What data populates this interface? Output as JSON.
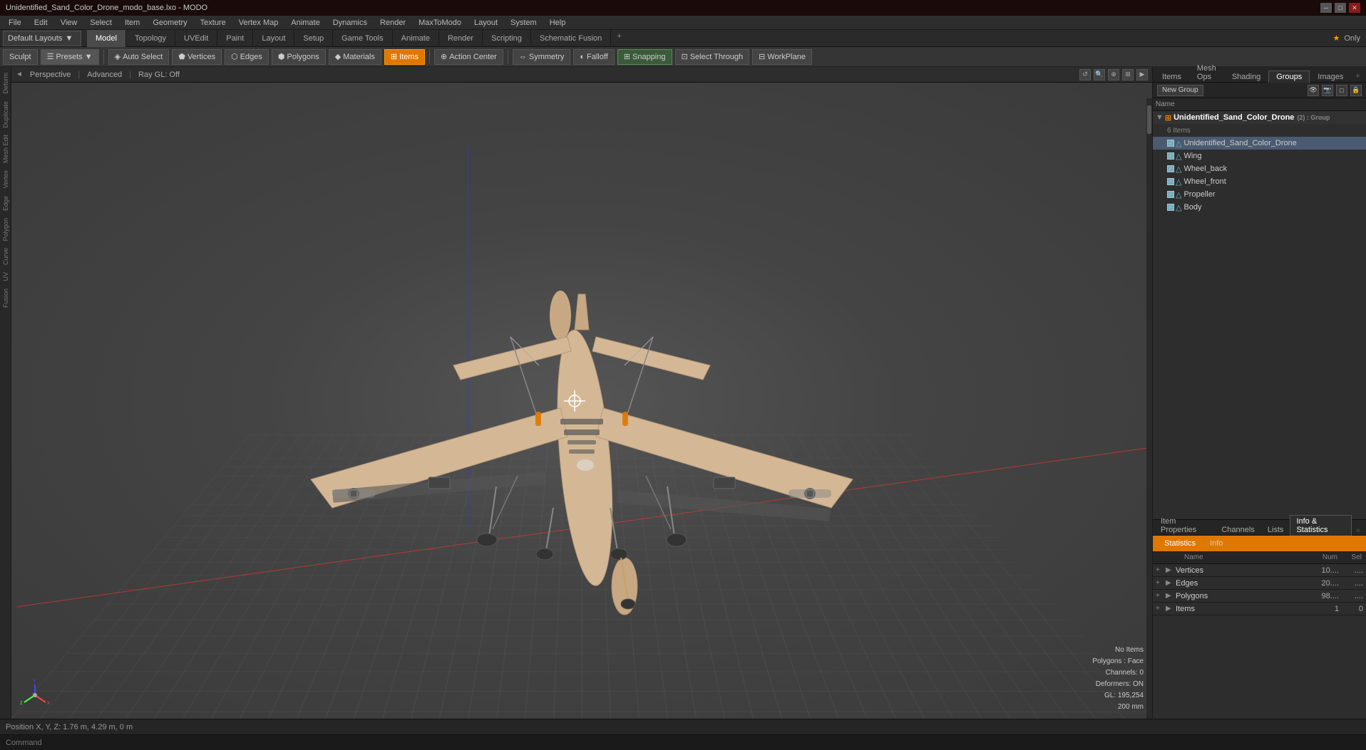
{
  "titlebar": {
    "title": "Unidentified_Sand_Color_Drone_modo_base.lxo - MODO",
    "minimize": "─",
    "maximize": "□",
    "close": "✕"
  },
  "menubar": {
    "items": [
      "File",
      "Edit",
      "View",
      "Select",
      "Item",
      "Geometry",
      "Texture",
      "Vertex Map",
      "Animate",
      "Dynamics",
      "Render",
      "MaxToModo",
      "Layout",
      "System",
      "Help"
    ]
  },
  "layoutbar": {
    "dropdown_label": "Default Layouts",
    "tabs": [
      "Model",
      "Topology",
      "UVEdit",
      "Paint",
      "Layout",
      "Setup",
      "Game Tools",
      "Animate",
      "Render",
      "Scripting",
      "Schematic Fusion"
    ],
    "add_tab": "+",
    "star_label": "★ Only"
  },
  "toolbar": {
    "sculpt": "Sculpt",
    "presets": "Presets",
    "presets_arrow": "▼",
    "auto_select": "Auto Select",
    "vertices": "Vertices",
    "edges": "Edges",
    "polygons": "Polygons",
    "materials": "Materials",
    "items": "Items",
    "action_center": "Action Center",
    "pipe": "|",
    "symmetry": "Symmetry",
    "falloff": "Falloff",
    "snapping": "Snapping",
    "select_through": "Select Through",
    "workplane": "WorkPlane"
  },
  "viewport": {
    "back_arrow": "◄",
    "forward_arrow": "►",
    "perspective": "Perspective",
    "advanced": "Advanced",
    "raygl": "Ray GL: Off",
    "ctrl_icons": [
      "↺",
      "🔍",
      "⊕",
      "⊞",
      "▶"
    ]
  },
  "viewport_info": {
    "no_items": "No Items",
    "polygons_face": "Polygons : Face",
    "channels": "Channels: 0",
    "deformers": "Deformers: ON",
    "gl": "GL: 195,254",
    "size": "200 mm"
  },
  "statusbar": {
    "position": "Position X, Y, Z:  1.76 m, 4.29 m, 0 m",
    "command_label": "Command"
  },
  "right_panel": {
    "tabs": [
      "Items",
      "Mesh Ops",
      "Shading",
      "Groups",
      "Images"
    ],
    "active_tab": "Groups",
    "add_tab": "+",
    "new_group_btn": "New Group",
    "collapse_btn": "«"
  },
  "group_panel": {
    "toolbar_icons": [
      "eye",
      "camera",
      "square",
      "lock"
    ],
    "name_col": "Name",
    "tree": {
      "root": {
        "name": "Unidentified_Sand_Color_Drone",
        "suffix": "(2) : Group",
        "count_label": "6 Items",
        "children": [
          {
            "name": "Unidentified_Sand_Color_Drone",
            "icon": "mesh"
          },
          {
            "name": "Wing",
            "icon": "mesh"
          },
          {
            "name": "Wheel_back",
            "icon": "mesh"
          },
          {
            "name": "Wheel_front",
            "icon": "mesh"
          },
          {
            "name": "Propeller",
            "icon": "mesh"
          },
          {
            "name": "Body",
            "icon": "mesh"
          }
        ]
      }
    }
  },
  "bottom_panel": {
    "tabs": [
      "Item Properties",
      "Channels",
      "Lists",
      "Info & Statistics"
    ],
    "active_tab": "Info & Statistics",
    "stats_tab": "Statistics",
    "info_tab": "Info",
    "table_headers": {
      "name": "Name",
      "num": "Num",
      "sel": "Sel"
    },
    "rows": [
      {
        "name": "Vertices",
        "num": "10....",
        "sel": "..."
      },
      {
        "name": "Edges",
        "num": "20....",
        "sel": "..."
      },
      {
        "name": "Polygons",
        "num": "98....",
        "sel": "..."
      },
      {
        "name": "Items",
        "num": "1",
        "sel": "0"
      }
    ]
  },
  "command_bar": {
    "placeholder": "Command"
  }
}
